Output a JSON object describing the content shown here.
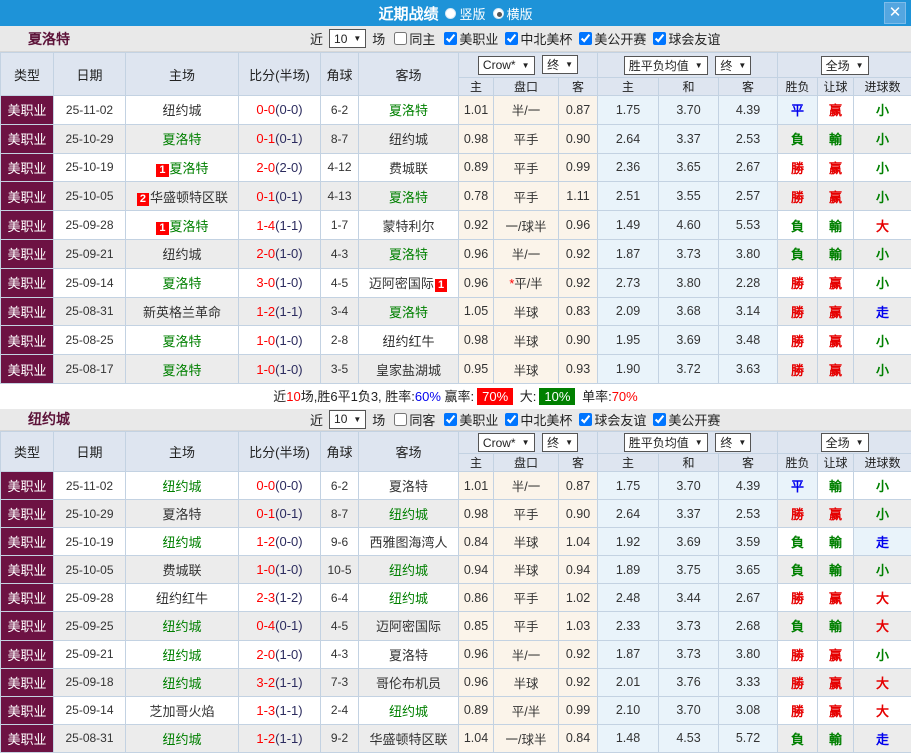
{
  "titlebar": {
    "title": "近期战绩",
    "radio_options": [
      {
        "label": "竖版",
        "selected": false
      },
      {
        "label": "横版",
        "selected": true
      }
    ],
    "close_icon": "close-x"
  },
  "ui": {
    "recent_label": "近",
    "games_label": "场"
  },
  "columns": {
    "type": "类型",
    "date": "日期",
    "home": "主场",
    "score": "比分(半场)",
    "corner": "角球",
    "away": "客场",
    "asian_home": "主",
    "handicap": "盘口",
    "asian_away": "客",
    "eu_home": "主",
    "eu_draw": "和",
    "eu_away": "客",
    "result": "胜负",
    "handicap_result": "让球",
    "goals": "进球数",
    "bookmaker_select": "Crow*",
    "final_select_1": "终",
    "avg_select": "胜平负均值",
    "final_select_2": "终",
    "fullmatch_select": "全场"
  },
  "sections": [
    {
      "team": "夏洛特",
      "filter": {
        "recent_value": "10",
        "same_label": "同主",
        "same_checked": false,
        "competitions": [
          {
            "label": "美职业",
            "checked": true
          },
          {
            "label": "中北美杯",
            "checked": true
          },
          {
            "label": "美公开赛",
            "checked": true
          },
          {
            "label": "球会友谊",
            "checked": true
          }
        ]
      },
      "rows": [
        {
          "type": "美职业",
          "date": "25-11-02",
          "home": "纽约城",
          "home_green": false,
          "home_badge": "",
          "score": "0-0",
          "half": "(0-0)",
          "corner": "6-2",
          "away": "夏洛特",
          "away_green": true,
          "away_badge": "",
          "o1": "1.01",
          "pk": "半/一",
          "star": false,
          "o2": "0.87",
          "e1": "1.75",
          "e2": "3.70",
          "e3": "4.39",
          "r1": {
            "t": "平",
            "c": "blue"
          },
          "r2": {
            "t": "赢",
            "c": "red"
          },
          "r3": {
            "t": "小",
            "c": "green"
          }
        },
        {
          "type": "美职业",
          "date": "25-10-29",
          "home": "夏洛特",
          "home_green": true,
          "home_badge": "",
          "score": "0-1",
          "half": "(0-1)",
          "corner": "8-7",
          "away": "纽约城",
          "away_green": false,
          "away_badge": "",
          "o1": "0.98",
          "pk": "平手",
          "star": false,
          "o2": "0.90",
          "e1": "2.64",
          "e2": "3.37",
          "e3": "2.53",
          "r1": {
            "t": "負",
            "c": "green"
          },
          "r2": {
            "t": "輸",
            "c": "green"
          },
          "r3": {
            "t": "小",
            "c": "green"
          }
        },
        {
          "type": "美职业",
          "date": "25-10-19",
          "home": "夏洛特",
          "home_green": true,
          "home_badge": "1",
          "score": "2-0",
          "half": "(2-0)",
          "corner": "4-12",
          "away": "费城联",
          "away_green": false,
          "away_badge": "",
          "o1": "0.89",
          "pk": "平手",
          "star": false,
          "o2": "0.99",
          "e1": "2.36",
          "e2": "3.65",
          "e3": "2.67",
          "r1": {
            "t": "勝",
            "c": "red"
          },
          "r2": {
            "t": "赢",
            "c": "red"
          },
          "r3": {
            "t": "小",
            "c": "green"
          }
        },
        {
          "type": "美职业",
          "date": "25-10-05",
          "home": "华盛顿特区联",
          "home_green": false,
          "home_badge": "2",
          "score": "0-1",
          "half": "(0-1)",
          "corner": "4-13",
          "away": "夏洛特",
          "away_green": true,
          "away_badge": "",
          "o1": "0.78",
          "pk": "平手",
          "star": false,
          "o2": "1.11",
          "e1": "2.51",
          "e2": "3.55",
          "e3": "2.57",
          "r1": {
            "t": "勝",
            "c": "red"
          },
          "r2": {
            "t": "赢",
            "c": "red"
          },
          "r3": {
            "t": "小",
            "c": "green"
          }
        },
        {
          "type": "美职业",
          "date": "25-09-28",
          "home": "夏洛特",
          "home_green": true,
          "home_badge": "1",
          "score": "1-4",
          "half": "(1-1)",
          "corner": "1-7",
          "away": "蒙特利尔",
          "away_green": false,
          "away_badge": "",
          "o1": "0.92",
          "pk": "一/球半",
          "star": false,
          "o2": "0.96",
          "e1": "1.49",
          "e2": "4.60",
          "e3": "5.53",
          "r1": {
            "t": "負",
            "c": "green"
          },
          "r2": {
            "t": "輸",
            "c": "green"
          },
          "r3": {
            "t": "大",
            "c": "red"
          }
        },
        {
          "type": "美职业",
          "date": "25-09-21",
          "home": "纽约城",
          "home_green": false,
          "home_badge": "",
          "score": "2-0",
          "half": "(1-0)",
          "corner": "4-3",
          "away": "夏洛特",
          "away_green": true,
          "away_badge": "",
          "o1": "0.96",
          "pk": "半/一",
          "star": false,
          "o2": "0.92",
          "e1": "1.87",
          "e2": "3.73",
          "e3": "3.80",
          "r1": {
            "t": "負",
            "c": "green"
          },
          "r2": {
            "t": "輸",
            "c": "green"
          },
          "r3": {
            "t": "小",
            "c": "green"
          }
        },
        {
          "type": "美职业",
          "date": "25-09-14",
          "home": "夏洛特",
          "home_green": true,
          "home_badge": "",
          "score": "3-0",
          "half": "(1-0)",
          "corner": "4-5",
          "away": "迈阿密国际",
          "away_green": false,
          "away_badge": "1",
          "o1": "0.96",
          "pk": "平/半",
          "star": true,
          "o2": "0.92",
          "e1": "2.73",
          "e2": "3.80",
          "e3": "2.28",
          "r1": {
            "t": "勝",
            "c": "red"
          },
          "r2": {
            "t": "赢",
            "c": "red"
          },
          "r3": {
            "t": "小",
            "c": "green"
          }
        },
        {
          "type": "美职业",
          "date": "25-08-31",
          "home": "新英格兰革命",
          "home_green": false,
          "home_badge": "",
          "score": "1-2",
          "half": "(1-1)",
          "corner": "3-4",
          "away": "夏洛特",
          "away_green": true,
          "away_badge": "",
          "o1": "1.05",
          "pk": "半球",
          "star": false,
          "o2": "0.83",
          "e1": "2.09",
          "e2": "3.68",
          "e3": "3.14",
          "r1": {
            "t": "勝",
            "c": "red"
          },
          "r2": {
            "t": "赢",
            "c": "red"
          },
          "r3": {
            "t": "走",
            "c": "blue"
          }
        },
        {
          "type": "美职业",
          "date": "25-08-25",
          "home": "夏洛特",
          "home_green": true,
          "home_badge": "",
          "score": "1-0",
          "half": "(1-0)",
          "corner": "2-8",
          "away": "纽约红牛",
          "away_green": false,
          "away_badge": "",
          "o1": "0.98",
          "pk": "半球",
          "star": false,
          "o2": "0.90",
          "e1": "1.95",
          "e2": "3.69",
          "e3": "3.48",
          "r1": {
            "t": "勝",
            "c": "red"
          },
          "r2": {
            "t": "赢",
            "c": "red"
          },
          "r3": {
            "t": "小",
            "c": "green"
          }
        },
        {
          "type": "美职业",
          "date": "25-08-17",
          "home": "夏洛特",
          "home_green": true,
          "home_badge": "",
          "score": "1-0",
          "half": "(1-0)",
          "corner": "3-5",
          "away": "皇家盐湖城",
          "away_green": false,
          "away_badge": "",
          "o1": "0.95",
          "pk": "半球",
          "star": false,
          "o2": "0.93",
          "e1": "1.90",
          "e2": "3.72",
          "e3": "3.63",
          "r1": {
            "t": "勝",
            "c": "red"
          },
          "r2": {
            "t": "赢",
            "c": "red"
          },
          "r3": {
            "t": "小",
            "c": "green"
          }
        }
      ],
      "summary": {
        "segments": [
          {
            "t": "近",
            "s": "black"
          },
          {
            "t": "10",
            "s": "red"
          },
          {
            "t": "场,胜6平1负3, 胜率:",
            "s": "black"
          },
          {
            "t": "60%",
            "s": "blue"
          },
          {
            "t": " 赢率:",
            "s": "black"
          },
          {
            "t": "70%",
            "s": "red-block"
          },
          {
            "t": " 大:",
            "s": "black"
          },
          {
            "t": "10%",
            "s": "green-block"
          },
          {
            "t": " 单率:",
            "s": "black"
          },
          {
            "t": "70%",
            "s": "red"
          }
        ]
      }
    },
    {
      "team": "纽约城",
      "filter": {
        "recent_value": "10",
        "same_label": "同客",
        "same_checked": false,
        "competitions": [
          {
            "label": "美职业",
            "checked": true
          },
          {
            "label": "中北美杯",
            "checked": true
          },
          {
            "label": "球会友谊",
            "checked": true
          },
          {
            "label": "美公开赛",
            "checked": true
          }
        ]
      },
      "rows": [
        {
          "type": "美职业",
          "date": "25-11-02",
          "home": "纽约城",
          "home_green": true,
          "home_badge": "",
          "score": "0-0",
          "half": "(0-0)",
          "corner": "6-2",
          "away": "夏洛特",
          "away_green": false,
          "away_badge": "",
          "o1": "1.01",
          "pk": "半/一",
          "star": false,
          "o2": "0.87",
          "e1": "1.75",
          "e2": "3.70",
          "e3": "4.39",
          "r1": {
            "t": "平",
            "c": "blue"
          },
          "r2": {
            "t": "輸",
            "c": "green"
          },
          "r3": {
            "t": "小",
            "c": "green"
          }
        },
        {
          "type": "美职业",
          "date": "25-10-29",
          "home": "夏洛特",
          "home_green": false,
          "home_badge": "",
          "score": "0-1",
          "half": "(0-1)",
          "corner": "8-7",
          "away": "纽约城",
          "away_green": true,
          "away_badge": "",
          "o1": "0.98",
          "pk": "平手",
          "star": false,
          "o2": "0.90",
          "e1": "2.64",
          "e2": "3.37",
          "e3": "2.53",
          "r1": {
            "t": "勝",
            "c": "red"
          },
          "r2": {
            "t": "赢",
            "c": "red"
          },
          "r3": {
            "t": "小",
            "c": "green"
          }
        },
        {
          "type": "美职业",
          "date": "25-10-19",
          "home": "纽约城",
          "home_green": true,
          "home_badge": "",
          "score": "1-2",
          "half": "(0-0)",
          "corner": "9-6",
          "away": "西雅图海湾人",
          "away_green": false,
          "away_badge": "",
          "o1": "0.84",
          "pk": "半球",
          "star": false,
          "o2": "1.04",
          "e1": "1.92",
          "e2": "3.69",
          "e3": "3.59",
          "r1": {
            "t": "負",
            "c": "green"
          },
          "r2": {
            "t": "輸",
            "c": "green"
          },
          "r3": {
            "t": "走",
            "c": "blue"
          }
        },
        {
          "type": "美职业",
          "date": "25-10-05",
          "home": "费城联",
          "home_green": false,
          "home_badge": "",
          "score": "1-0",
          "half": "(1-0)",
          "corner": "10-5",
          "away": "纽约城",
          "away_green": true,
          "away_badge": "",
          "o1": "0.94",
          "pk": "半球",
          "star": false,
          "o2": "0.94",
          "e1": "1.89",
          "e2": "3.75",
          "e3": "3.65",
          "r1": {
            "t": "負",
            "c": "green"
          },
          "r2": {
            "t": "輸",
            "c": "green"
          },
          "r3": {
            "t": "小",
            "c": "green"
          }
        },
        {
          "type": "美职业",
          "date": "25-09-28",
          "home": "纽约红牛",
          "home_green": false,
          "home_badge": "",
          "score": "2-3",
          "half": "(1-2)",
          "corner": "6-4",
          "away": "纽约城",
          "away_green": true,
          "away_badge": "",
          "o1": "0.86",
          "pk": "平手",
          "star": false,
          "o2": "1.02",
          "e1": "2.48",
          "e2": "3.44",
          "e3": "2.67",
          "r1": {
            "t": "勝",
            "c": "red"
          },
          "r2": {
            "t": "赢",
            "c": "red"
          },
          "r3": {
            "t": "大",
            "c": "red"
          }
        },
        {
          "type": "美职业",
          "date": "25-09-25",
          "home": "纽约城",
          "home_green": true,
          "home_badge": "",
          "score": "0-4",
          "half": "(0-1)",
          "corner": "4-5",
          "away": "迈阿密国际",
          "away_green": false,
          "away_badge": "",
          "o1": "0.85",
          "pk": "平手",
          "star": false,
          "o2": "1.03",
          "e1": "2.33",
          "e2": "3.73",
          "e3": "2.68",
          "r1": {
            "t": "負",
            "c": "green"
          },
          "r2": {
            "t": "輸",
            "c": "green"
          },
          "r3": {
            "t": "大",
            "c": "red"
          }
        },
        {
          "type": "美职业",
          "date": "25-09-21",
          "home": "纽约城",
          "home_green": true,
          "home_badge": "",
          "score": "2-0",
          "half": "(1-0)",
          "corner": "4-3",
          "away": "夏洛特",
          "away_green": false,
          "away_badge": "",
          "o1": "0.96",
          "pk": "半/一",
          "star": false,
          "o2": "0.92",
          "e1": "1.87",
          "e2": "3.73",
          "e3": "3.80",
          "r1": {
            "t": "勝",
            "c": "red"
          },
          "r2": {
            "t": "赢",
            "c": "red"
          },
          "r3": {
            "t": "小",
            "c": "green"
          }
        },
        {
          "type": "美职业",
          "date": "25-09-18",
          "home": "纽约城",
          "home_green": true,
          "home_badge": "",
          "score": "3-2",
          "half": "(1-1)",
          "corner": "7-3",
          "away": "哥伦布机员",
          "away_green": false,
          "away_badge": "",
          "o1": "0.96",
          "pk": "半球",
          "star": false,
          "o2": "0.92",
          "e1": "2.01",
          "e2": "3.76",
          "e3": "3.33",
          "r1": {
            "t": "勝",
            "c": "red"
          },
          "r2": {
            "t": "赢",
            "c": "red"
          },
          "r3": {
            "t": "大",
            "c": "red"
          }
        },
        {
          "type": "美职业",
          "date": "25-09-14",
          "home": "芝加哥火焰",
          "home_green": false,
          "home_badge": "",
          "score": "1-3",
          "half": "(1-1)",
          "corner": "2-4",
          "away": "纽约城",
          "away_green": true,
          "away_badge": "",
          "o1": "0.89",
          "pk": "平/半",
          "star": false,
          "o2": "0.99",
          "e1": "2.10",
          "e2": "3.70",
          "e3": "3.08",
          "r1": {
            "t": "勝",
            "c": "red"
          },
          "r2": {
            "t": "赢",
            "c": "red"
          },
          "r3": {
            "t": "大",
            "c": "red"
          }
        },
        {
          "type": "美职业",
          "date": "25-08-31",
          "home": "纽约城",
          "home_green": true,
          "home_badge": "",
          "score": "1-2",
          "half": "(1-1)",
          "corner": "9-2",
          "away": "华盛顿特区联",
          "away_green": false,
          "away_badge": "",
          "o1": "1.04",
          "pk": "一/球半",
          "star": false,
          "o2": "0.84",
          "e1": "1.48",
          "e2": "4.53",
          "e3": "5.72",
          "r1": {
            "t": "負",
            "c": "green"
          },
          "r2": {
            "t": "輸",
            "c": "green"
          },
          "r3": {
            "t": "走",
            "c": "blue"
          }
        }
      ],
      "summary": null
    }
  ],
  "colors": {
    "titlebar_blue": "#1e93d8",
    "type_cell_maroon": "#6d1243",
    "team_green": "#008000",
    "win_red": "#e60000",
    "lose_green": "#008000",
    "draw_blue": "#0000ee",
    "asian_col_bg": "#fbf4ea",
    "eu_col_bg": "#e9f3fa",
    "header_bg": "#dee5f0"
  }
}
